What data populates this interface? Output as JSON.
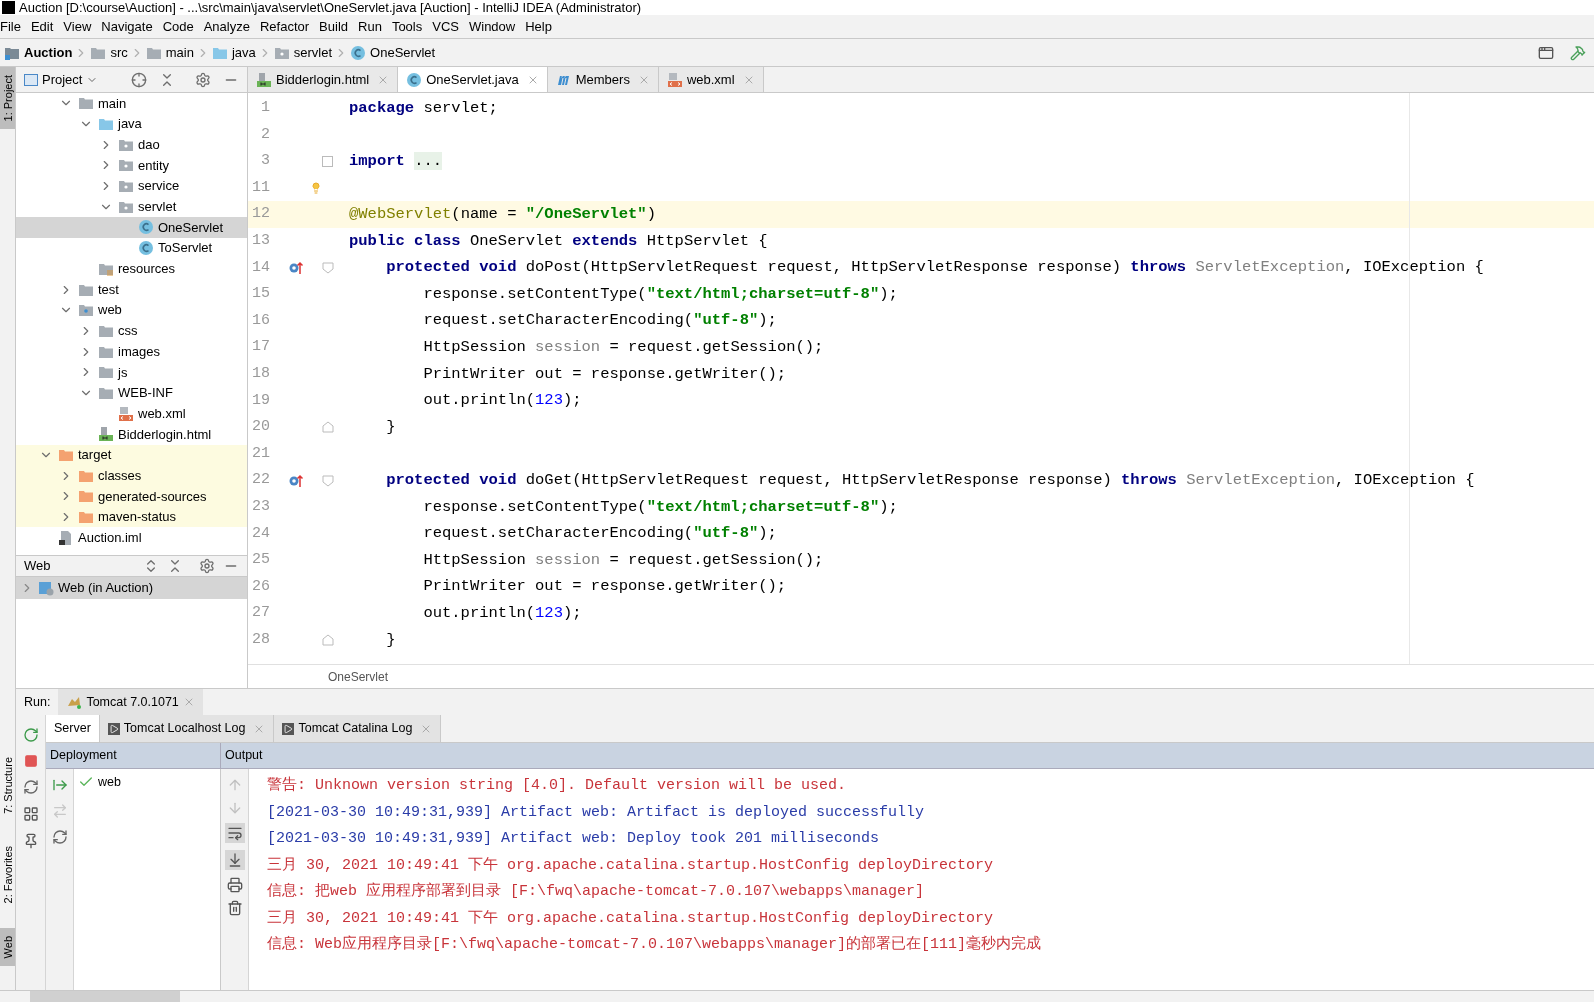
{
  "window": {
    "title": "Auction [D:\\course\\Auction] - ...\\src\\main\\java\\servlet\\OneServlet.java [Auction] - IntelliJ IDEA (Administrator)"
  },
  "menu": [
    "File",
    "Edit",
    "View",
    "Navigate",
    "Code",
    "Analyze",
    "Refactor",
    "Build",
    "Run",
    "Tools",
    "VCS",
    "Window",
    "Help"
  ],
  "breadcrumb": [
    {
      "label": "Auction",
      "kind": "module"
    },
    {
      "label": "src",
      "kind": "folder"
    },
    {
      "label": "main",
      "kind": "folder"
    },
    {
      "label": "java",
      "kind": "source"
    },
    {
      "label": "servlet",
      "kind": "package"
    },
    {
      "label": "OneServlet",
      "kind": "class"
    }
  ],
  "side_stripe": {
    "top": [
      "1: Project"
    ],
    "bottom": [
      "7: Structure",
      "2: Favorites",
      "Web"
    ]
  },
  "project": {
    "title": "Project",
    "tree": [
      {
        "children": [
          {
            "label": "main",
            "kind": "folder",
            "expanded": true,
            "selected": false,
            "children": [
              {
                "label": "java",
                "kind": "source",
                "expanded": true,
                "selected": false,
                "children": [
                  {
                    "label": "dao",
                    "kind": "package",
                    "expanded": false,
                    "selected": false
                  },
                  {
                    "label": "entity",
                    "kind": "package",
                    "expanded": false,
                    "selected": false
                  },
                  {
                    "label": "service",
                    "kind": "package",
                    "expanded": false,
                    "selected": false
                  },
                  {
                    "label": "servlet",
                    "kind": "package",
                    "expanded": true,
                    "selected": false,
                    "children": [
                      {
                        "label": "OneServlet",
                        "kind": "class",
                        "selected": true
                      },
                      {
                        "label": "ToServlet",
                        "kind": "class",
                        "selected": false
                      }
                    ]
                  }
                ]
              },
              {
                "label": "resources",
                "kind": "resources",
                "selected": false
              }
            ]
          },
          {
            "label": "test",
            "kind": "folder",
            "expanded": false,
            "selected": false
          },
          {
            "label": "web",
            "kind": "web",
            "expanded": true,
            "selected": false,
            "children": [
              {
                "label": "css",
                "kind": "folder",
                "expanded": false,
                "selected": false
              },
              {
                "label": "images",
                "kind": "folder",
                "expanded": false,
                "selected": false
              },
              {
                "label": "js",
                "kind": "folder",
                "expanded": false,
                "selected": false
              },
              {
                "label": "WEB-INF",
                "kind": "folder",
                "expanded": true,
                "selected": false,
                "children": [
                  {
                    "label": "web.xml",
                    "kind": "xml",
                    "selected": false
                  }
                ]
              },
              {
                "label": "Bidderlogin.html",
                "kind": "html",
                "selected": false
              }
            ]
          }
        ]
      },
      {
        "label": "target",
        "kind": "excluded",
        "expanded": true,
        "selected": false,
        "children": [
          {
            "label": "classes",
            "kind": "excluded",
            "expanded": false,
            "selected": false
          },
          {
            "label": "generated-sources",
            "kind": "excluded",
            "expanded": false,
            "selected": false
          },
          {
            "label": "maven-status",
            "kind": "excluded",
            "expanded": false,
            "selected": false
          }
        ]
      },
      {
        "label": "Auction.iml",
        "kind": "iml",
        "selected": false
      }
    ]
  },
  "web_panel": {
    "title": "Web",
    "items": [
      {
        "label": "Web (in Auction)",
        "expanded": false,
        "selected": true
      }
    ]
  },
  "editor_tabs": [
    {
      "label": "Bidderlogin.html",
      "kind": "html",
      "selected": false
    },
    {
      "label": "OneServlet.java",
      "kind": "class",
      "selected": true
    },
    {
      "label": "Members",
      "kind": "members",
      "selected": false
    },
    {
      "label": "web.xml",
      "kind": "xml",
      "selected": false
    }
  ],
  "editor": {
    "lines": [
      {
        "number": "1",
        "segments": [
          {
            "text": "package",
            "kind": "kw"
          },
          {
            "text": " servlet;",
            "kind": "plain"
          }
        ]
      },
      {
        "number": "2"
      },
      {
        "number": "3",
        "gutter": [
          {
            "kind": "fold_collapsed"
          }
        ],
        "segments": [
          {
            "text": "import ",
            "kind": "kw"
          },
          {
            "text": "...",
            "kind": "folded"
          }
        ]
      },
      {
        "number": "11",
        "gutter": [
          {
            "kind": "bulb"
          }
        ]
      },
      {
        "number": "12",
        "current": true,
        "segments": [
          {
            "text": "@WebServlet",
            "kind": "ann"
          },
          {
            "text": "(name = ",
            "kind": "plain"
          },
          {
            "text": "\"/OneServlet\"",
            "kind": "str"
          },
          {
            "text": ")",
            "kind": "plain"
          }
        ]
      },
      {
        "number": "13",
        "segments": [
          {
            "text": "public class",
            "kind": "kw"
          },
          {
            "text": " OneServlet ",
            "kind": "plain"
          },
          {
            "text": "extends",
            "kind": "kw"
          },
          {
            "text": " HttpServlet {",
            "kind": "plain"
          }
        ]
      },
      {
        "number": "14",
        "gutter": [
          {
            "kind": "override"
          },
          {
            "kind": "fold_start"
          }
        ],
        "segments": [
          {
            "text": "    protected void",
            "kind": "kw"
          },
          {
            "text": " doPost(HttpServletRequest request, HttpServletResponse response) ",
            "kind": "plain"
          },
          {
            "text": "throws",
            "kind": "kw"
          },
          {
            "text": " ServletException",
            "kind": "dim"
          },
          {
            "text": ", IOException {",
            "kind": "plain"
          }
        ]
      },
      {
        "number": "15",
        "segments": [
          {
            "text": "        response.setContentType(",
            "kind": "plain"
          },
          {
            "text": "\"text/html;charset=utf-8\"",
            "kind": "str"
          },
          {
            "text": ");",
            "kind": "plain"
          }
        ]
      },
      {
        "number": "16",
        "segments": [
          {
            "text": "        request.setCharacterEncoding(",
            "kind": "plain"
          },
          {
            "text": "\"utf-8\"",
            "kind": "str"
          },
          {
            "text": ");",
            "kind": "plain"
          }
        ]
      },
      {
        "number": "17",
        "segments": [
          {
            "text": "        HttpSession ",
            "kind": "plain"
          },
          {
            "text": "session",
            "kind": "dim"
          },
          {
            "text": " = request.getSession();",
            "kind": "plain"
          }
        ]
      },
      {
        "number": "18",
        "segments": [
          {
            "text": "        PrintWriter out = response.getWriter();",
            "kind": "plain"
          }
        ]
      },
      {
        "number": "19",
        "segments": [
          {
            "text": "        out.println(",
            "kind": "plain"
          },
          {
            "text": "123",
            "kind": "num"
          },
          {
            "text": ");",
            "kind": "plain"
          }
        ]
      },
      {
        "number": "20",
        "gutter": [
          {
            "kind": "fold_end"
          }
        ],
        "segments": [
          {
            "text": "    }",
            "kind": "plain"
          }
        ]
      },
      {
        "number": "21"
      },
      {
        "number": "22",
        "gutter": [
          {
            "kind": "override"
          },
          {
            "kind": "fold_start"
          }
        ],
        "segments": [
          {
            "text": "    protected void",
            "kind": "kw"
          },
          {
            "text": " doGet(HttpServletRequest request, HttpServletResponse response) ",
            "kind": "plain"
          },
          {
            "text": "throws",
            "kind": "kw"
          },
          {
            "text": " ServletException",
            "kind": "dim"
          },
          {
            "text": ", IOException {",
            "kind": "plain"
          }
        ]
      },
      {
        "number": "23",
        "segments": [
          {
            "text": "        response.setContentType(",
            "kind": "plain"
          },
          {
            "text": "\"text/html;charset=utf-8\"",
            "kind": "str"
          },
          {
            "text": ");",
            "kind": "plain"
          }
        ]
      },
      {
        "number": "24",
        "segments": [
          {
            "text": "        request.setCharacterEncoding(",
            "kind": "plain"
          },
          {
            "text": "\"utf-8\"",
            "kind": "str"
          },
          {
            "text": ");",
            "kind": "plain"
          }
        ]
      },
      {
        "number": "25",
        "segments": [
          {
            "text": "        HttpSession ",
            "kind": "plain"
          },
          {
            "text": "session",
            "kind": "dim"
          },
          {
            "text": " = request.getSession();",
            "kind": "plain"
          }
        ]
      },
      {
        "number": "26",
        "segments": [
          {
            "text": "        PrintWriter out = response.getWriter();",
            "kind": "plain"
          }
        ]
      },
      {
        "number": "27",
        "segments": [
          {
            "text": "        out.println(",
            "kind": "plain"
          },
          {
            "text": "123",
            "kind": "num"
          },
          {
            "text": ");",
            "kind": "plain"
          }
        ]
      },
      {
        "number": "28",
        "gutter": [
          {
            "kind": "fold_end"
          }
        ],
        "segments": [
          {
            "text": "    }",
            "kind": "plain"
          }
        ]
      }
    ],
    "footer": "OneServlet"
  },
  "run": {
    "label": "Run:",
    "configs": [
      {
        "label": "Tomcat 7.0.1071",
        "selected": true
      }
    ],
    "tabs": [
      {
        "label": "Server",
        "kind": "plain",
        "selected": true
      },
      {
        "label": "Tomcat Localhost Log",
        "kind": "log",
        "selected": false
      },
      {
        "label": "Tomcat Catalina Log",
        "kind": "log",
        "selected": false
      }
    ],
    "deployment": {
      "title": "Deployment",
      "items": [
        {
          "label": "web",
          "deployed": true
        }
      ]
    },
    "output": {
      "title": "Output",
      "lines": [
        {
          "text": "警告: Unknown version string [4.0]. Default version will be used.",
          "kind": "stderr"
        },
        {
          "text": "[2021-03-30 10:49:31,939] Artifact web: Artifact is deployed successfully",
          "kind": "system"
        },
        {
          "text": "[2021-03-30 10:49:31,939] Artifact web: Deploy took 201 milliseconds",
          "kind": "system"
        },
        {
          "text": "三月 30, 2021 10:49:41 下午 org.apache.catalina.startup.HostConfig deployDirectory",
          "kind": "stderr"
        },
        {
          "text": "信息: 把web 应用程序部署到目录 [F:\\fwq\\apache-tomcat-7.0.107\\webapps\\manager]",
          "kind": "stderr"
        },
        {
          "text": "三月 30, 2021 10:49:41 下午 org.apache.catalina.startup.HostConfig deployDirectory",
          "kind": "stderr"
        },
        {
          "text": "信息: Web应用程序目录[F:\\fwq\\apache-tomcat-7.0.107\\webapps\\manager]的部署已在[111]毫秒内完成",
          "kind": "stderr"
        }
      ]
    }
  }
}
